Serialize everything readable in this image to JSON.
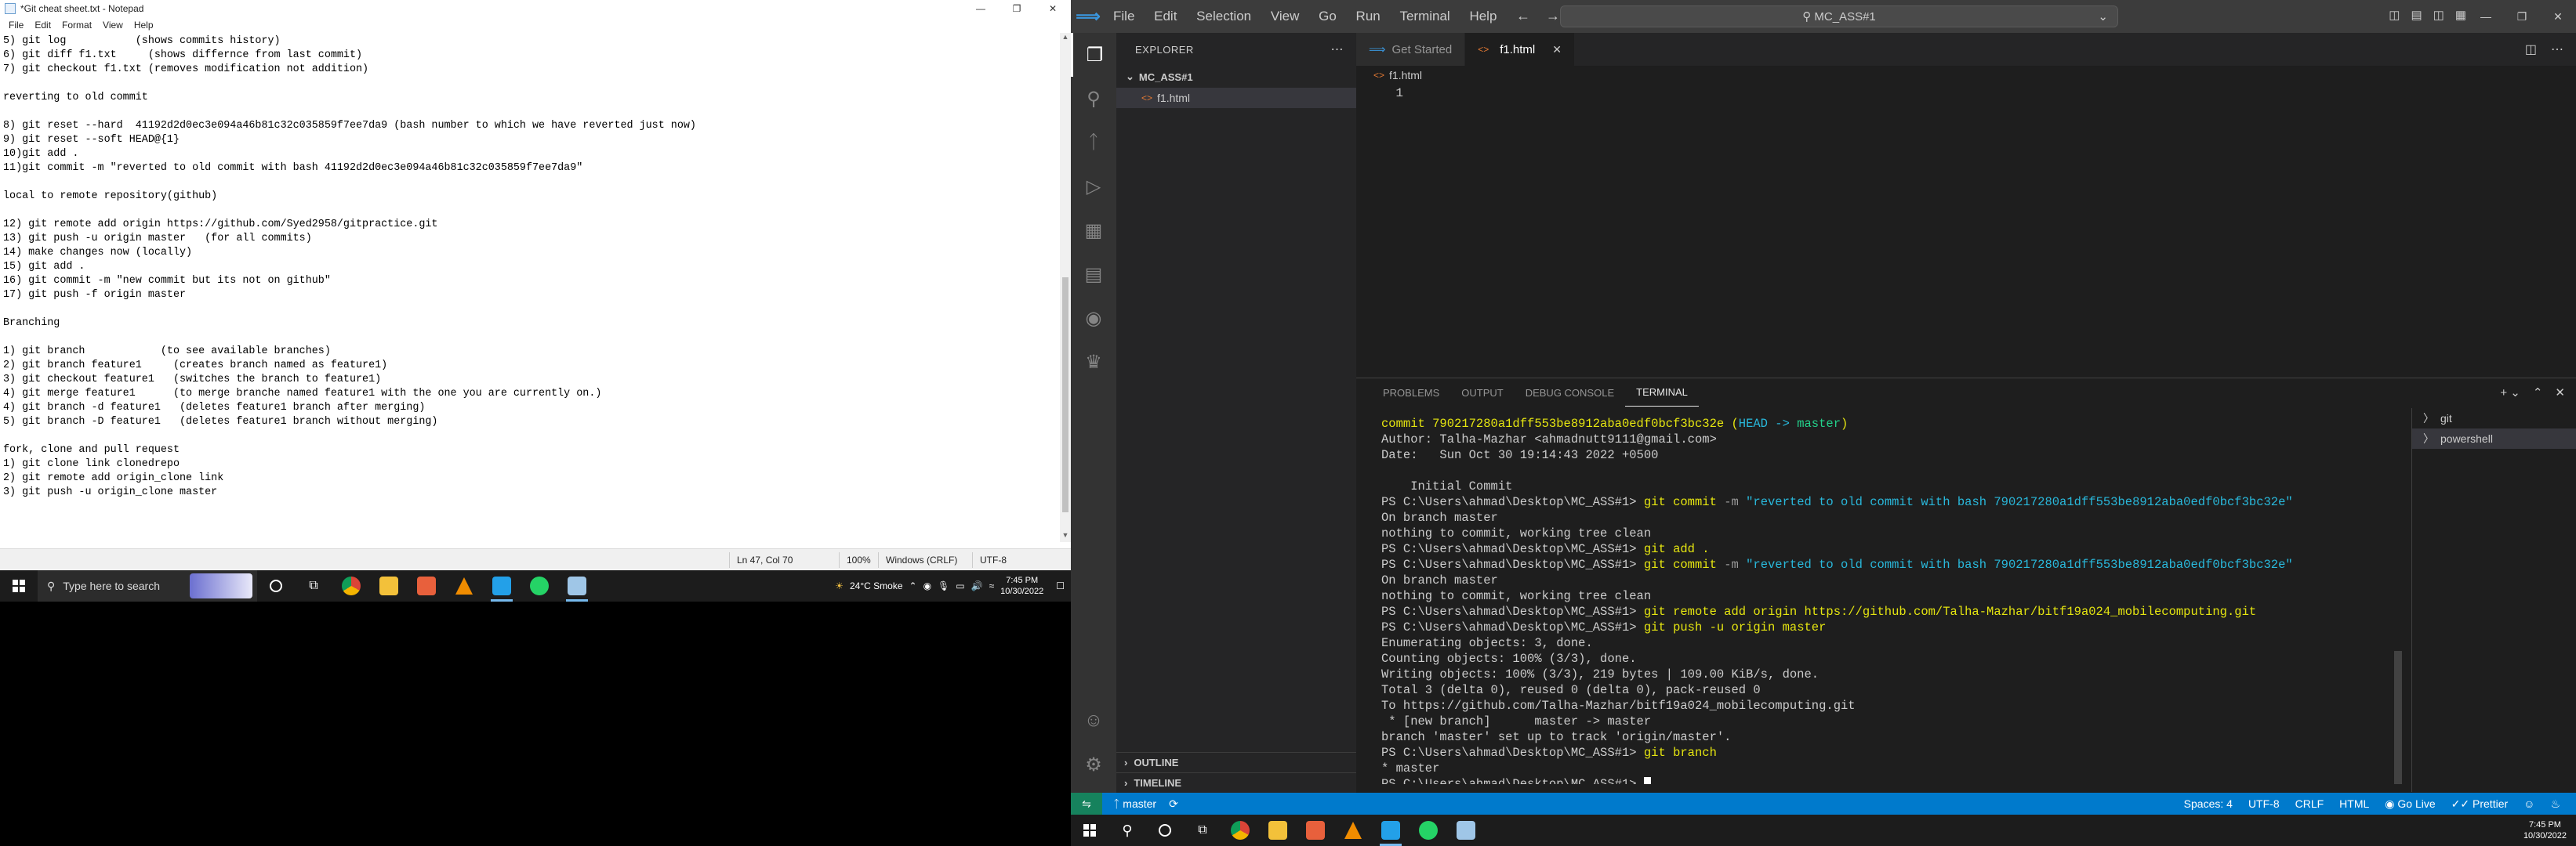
{
  "notepad": {
    "title": "*Git cheat sheet.txt - Notepad",
    "menu": [
      "File",
      "Edit",
      "Format",
      "View",
      "Help"
    ],
    "lines": [
      "5) git log           (shows commits history)",
      "6) git diff f1.txt     (shows differnce from last commit)",
      "7) git checkout f1.txt (removes modification not addition)",
      "",
      "reverting to old commit",
      "",
      "8) git reset --hard  41192d2d0ec3e094a46b81c32c035859f7ee7da9 (bash number to which we have reverted just now)",
      "9) git reset --soft HEAD@{1}",
      "10)git add .",
      "11)git commit -m \"reverted to old commit with bash 41192d2d0ec3e094a46b81c32c035859f7ee7da9\"",
      "",
      "local to remote repository(github)",
      "",
      "12) git remote add origin https://github.com/Syed2958/gitpractice.git",
      "13) git push -u origin master   (for all commits)",
      "14) make changes now (locally)",
      "15) git add .",
      "16) git commit -m \"new commit but its not on github\"",
      "17) git push -f origin master",
      "",
      "Branching",
      "",
      "1) git branch            (to see available branches)",
      "2) git branch feature1     (creates branch named as feature1)",
      "3) git checkout feature1   (switches the branch to feature1)",
      "4) git merge feature1      (to merge branche named feature1 with the one you are currently on.)",
      "4) git branch -d feature1   (deletes feature1 branch after merging)",
      "5) git branch -D feature1   (deletes feature1 branch without merging)",
      "",
      "fork, clone and pull request",
      "1) git clone link clonedrepo",
      "2) git remote add origin_clone link",
      "3) git push -u origin_clone master"
    ],
    "status": {
      "position": "Ln 47, Col 70",
      "zoom": "100%",
      "eol": "Windows (CRLF)",
      "encoding": "UTF-8"
    }
  },
  "taskbar_left": {
    "search_placeholder": "Type here to search",
    "weather": "24°C  Smoke",
    "time": "7:45 PM",
    "date": "10/30/2022"
  },
  "vscode": {
    "menu": [
      "File",
      "Edit",
      "Selection",
      "View",
      "Go",
      "Run",
      "Terminal",
      "Help"
    ],
    "command_center": "MC_ASS#1",
    "explorer_header": "EXPLORER",
    "folder": "MC_ASS#1",
    "file": "f1.html",
    "outline": "OUTLINE",
    "timeline": "TIMELINE",
    "tabs": [
      {
        "label": "Get Started"
      },
      {
        "label": "f1.html"
      }
    ],
    "breadcrumb": "f1.html",
    "line_number": "1",
    "panel_tabs": [
      "PROBLEMS",
      "OUTPUT",
      "DEBUG CONSOLE",
      "TERMINAL"
    ],
    "terminals": [
      "git",
      "powershell"
    ],
    "terminal": {
      "commit_hash": "commit 790217280a1dff553be8912aba0edf0bcf3bc32e",
      "head_open": " (",
      "head_label": "HEAD -> ",
      "head_branch": "master",
      "head_close": ")",
      "author": "Author: Talha-Mazhar <ahmadnutt9111@gmail.com>",
      "date": "Date:   Sun Oct 30 19:14:43 2022 +0500",
      "initial_commit": "    Initial Commit",
      "prompt": "PS C:\\Users\\ahmad\\Desktop\\MC_ASS#1> ",
      "cmd1_git": "git commit ",
      "cmd1_flag": "-m ",
      "cmd1_msg": "\"reverted to old commit with bash 790217280a1dff553be8912aba0edf0bcf3bc32e\"",
      "on_branch": "On branch master",
      "nothing": "nothing to commit, working tree clean",
      "cmd_add": "git add .",
      "cmd_remote": "git remote add origin https://github.com/Talha-Mazhar/bitf19a024_mobilecomputing.git",
      "cmd_push": "git push -u origin master",
      "enum": "Enumerating objects: 3, done.",
      "count": "Counting objects: 100% (3/3), done.",
      "write": "Writing objects: 100% (3/3), 219 bytes | 109.00 KiB/s, done.",
      "total": "Total 3 (delta 0), reused 0 (delta 0), pack-reused 0",
      "to": "To https://github.com/Talha-Mazhar/bitf19a024_mobilecomputing.git",
      "newbranch": " * [new branch]      master -> master",
      "track": "branch 'master' set up to track 'origin/master'.",
      "cmd_branch": "git branch",
      "branch_out": "* master"
    },
    "status": {
      "branch": "master",
      "spaces": "Spaces: 4",
      "encoding": "UTF-8",
      "eol": "CRLF",
      "language": "HTML",
      "golive": "Go Live",
      "prettier": "Prettier"
    }
  },
  "taskbar_right": {
    "time": "7:45 PM",
    "date": "10/30/2022"
  }
}
